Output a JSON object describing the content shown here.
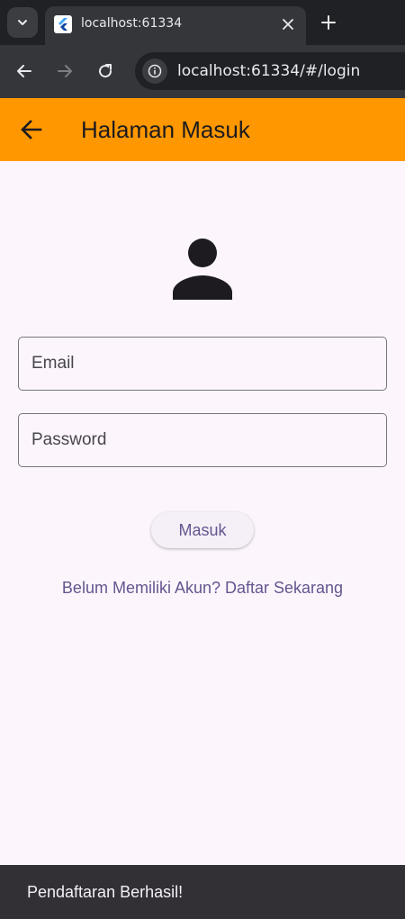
{
  "browser": {
    "tab_title": "localhost:61334",
    "url": "localhost:61334/#/login"
  },
  "appbar": {
    "title": "Halaman Masuk",
    "color": "#ff9800"
  },
  "form": {
    "email_placeholder": "Email",
    "password_placeholder": "Password",
    "submit_label": "Masuk",
    "register_link": "Belum Memiliki Akun? Daftar Sekarang"
  },
  "snackbar": {
    "message": "Pendaftaran Berhasil!"
  },
  "icons": {
    "favicon": "flutter-icon",
    "avatar": "person-icon"
  }
}
